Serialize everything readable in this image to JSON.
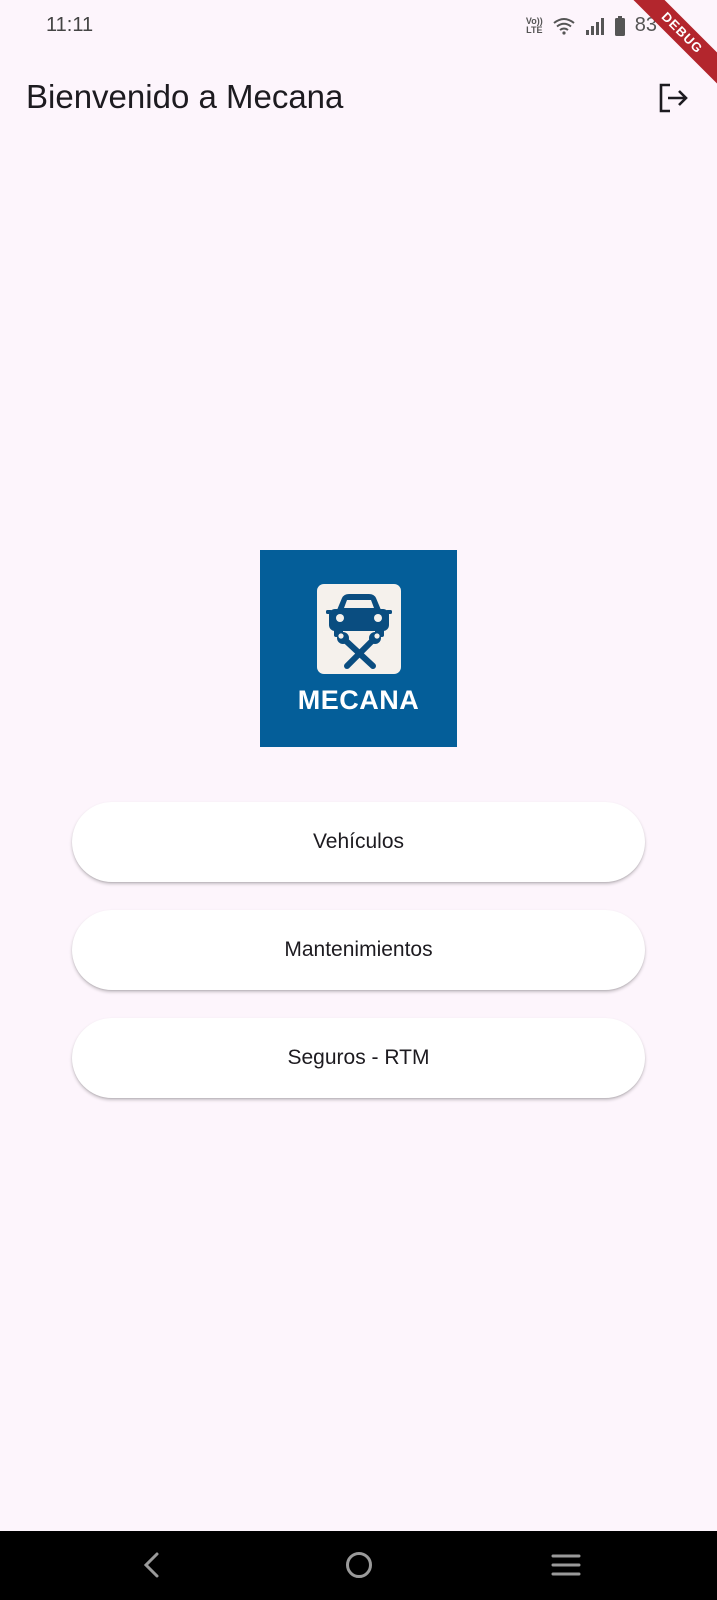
{
  "status_bar": {
    "time": "11:11",
    "volte_top": "Vo))",
    "volte_bottom": "LTE",
    "battery": "83"
  },
  "debug_banner": "DEBUG",
  "app_bar": {
    "title": "Bienvenido a Mecana",
    "logout_icon": "logout-icon"
  },
  "logo": {
    "text": "MECANA",
    "background": "#045e99",
    "icon": "car-wrench-icon"
  },
  "menu": {
    "items": [
      {
        "label": "Vehículos"
      },
      {
        "label": "Mantenimientos"
      },
      {
        "label": "Seguros - RTM"
      }
    ]
  },
  "nav_bar": {
    "back_icon": "back-icon",
    "home_icon": "home-icon",
    "recents_icon": "menu-icon"
  }
}
